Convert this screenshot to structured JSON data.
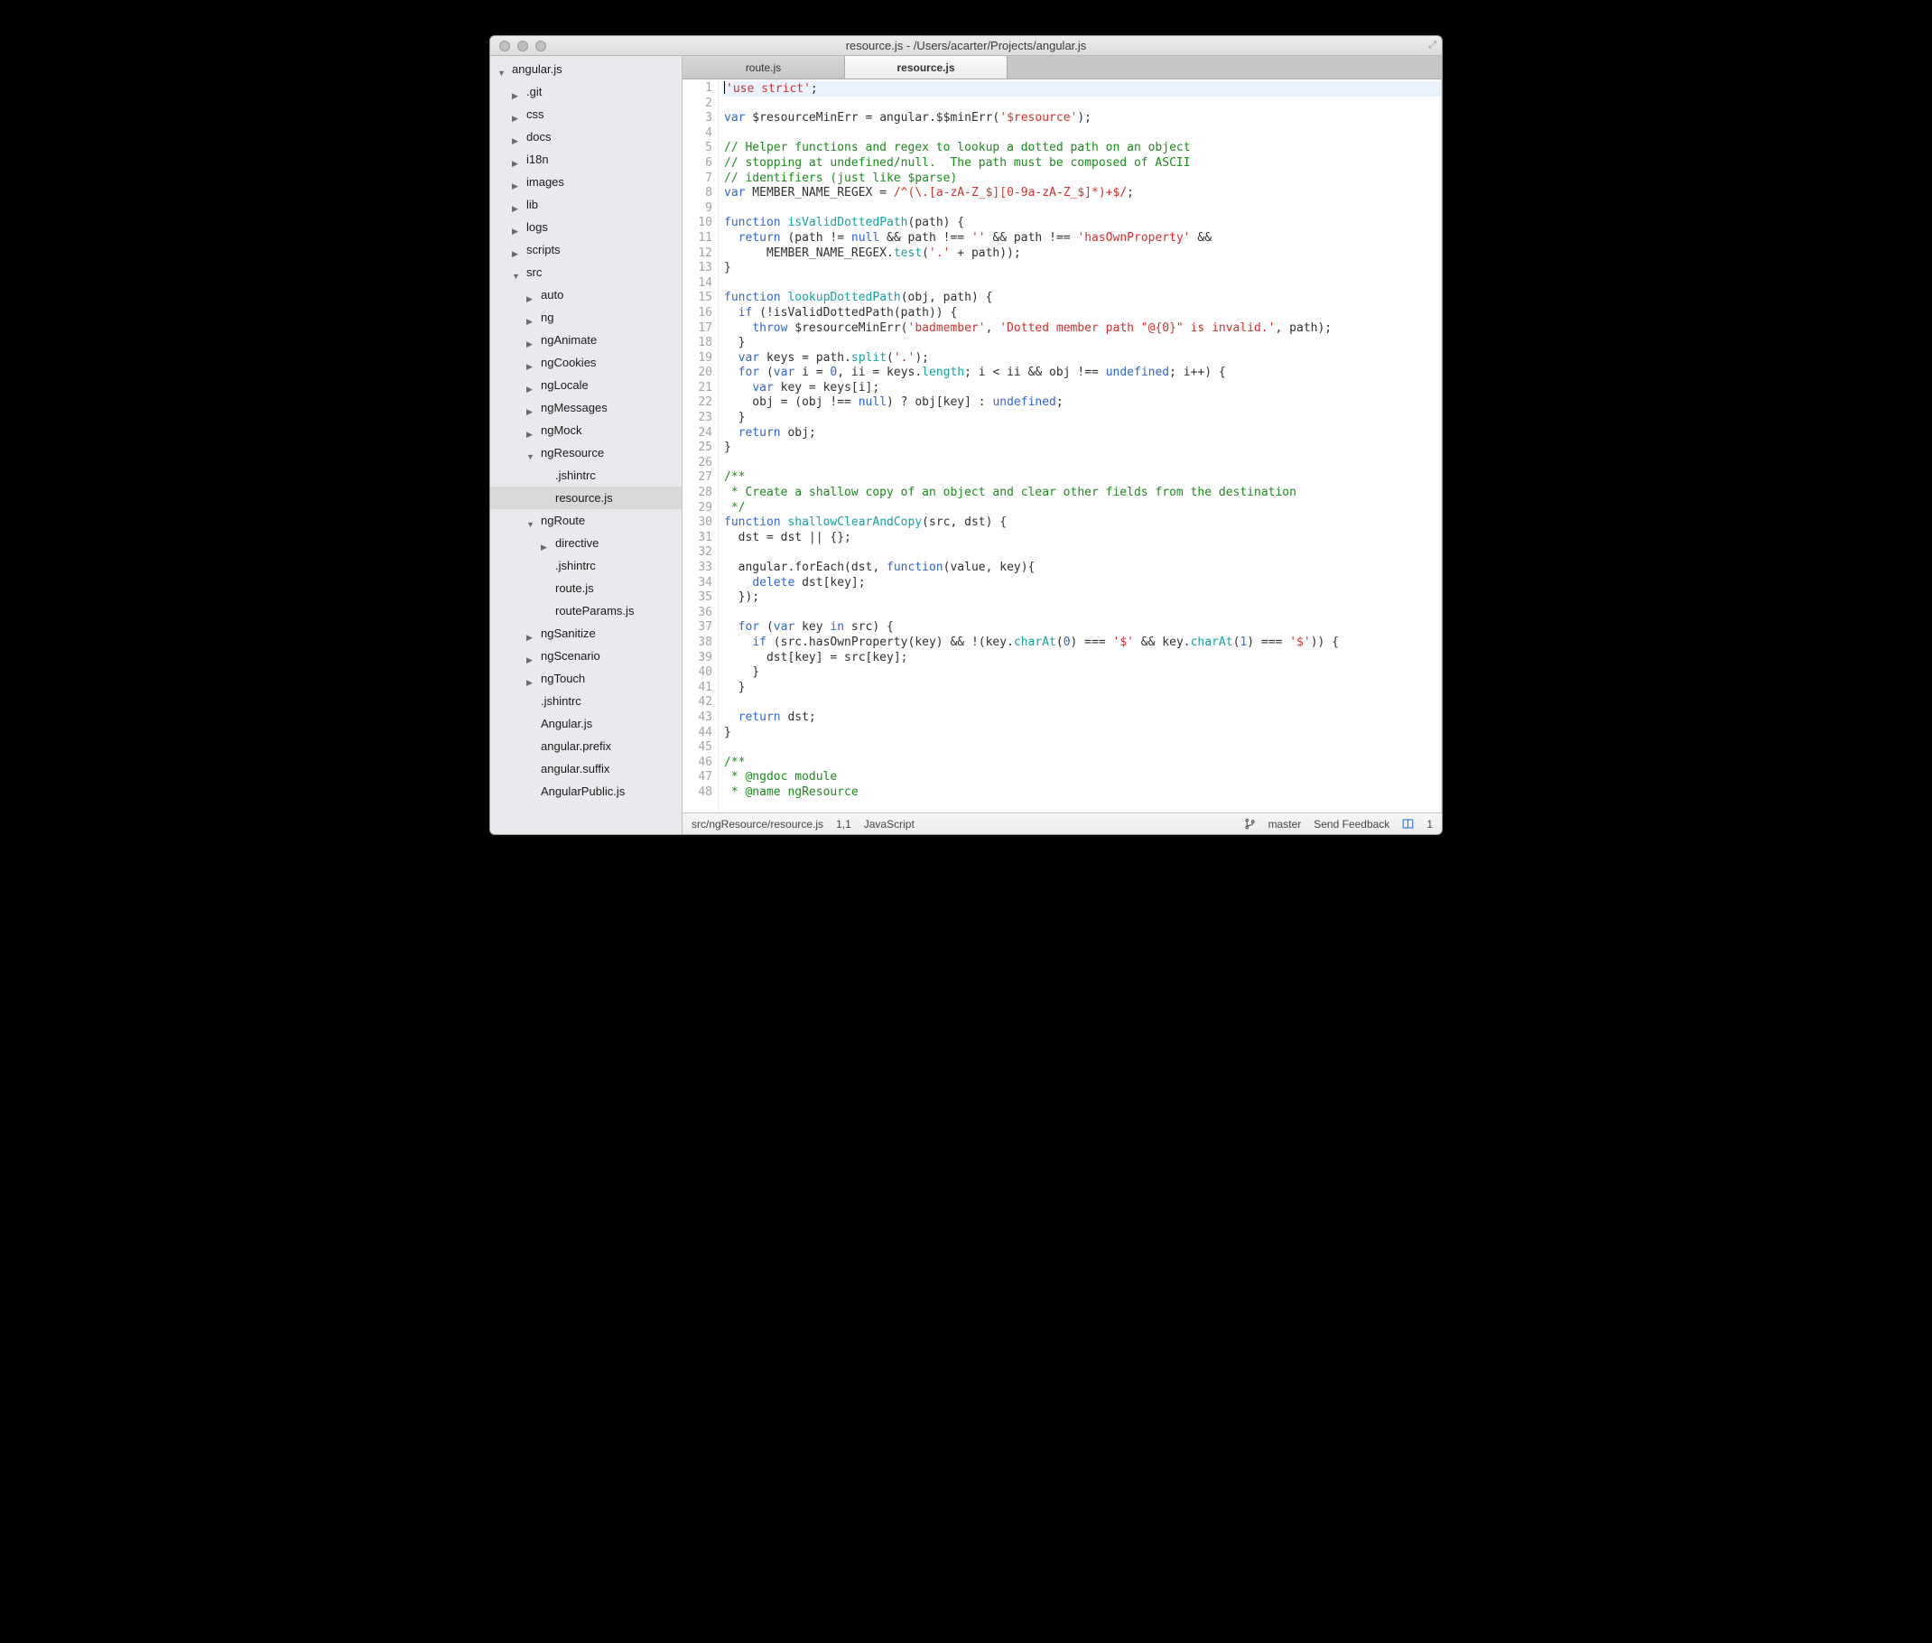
{
  "window": {
    "title": "resource.js - /Users/acarter/Projects/angular.js"
  },
  "tabs": [
    {
      "label": "route.js",
      "active": false
    },
    {
      "label": "resource.js",
      "active": true
    }
  ],
  "tree": [
    {
      "depth": 0,
      "arrow": "down",
      "label": "angular.js"
    },
    {
      "depth": 1,
      "arrow": "right",
      "label": ".git"
    },
    {
      "depth": 1,
      "arrow": "right",
      "label": "css"
    },
    {
      "depth": 1,
      "arrow": "right",
      "label": "docs"
    },
    {
      "depth": 1,
      "arrow": "right",
      "label": "i18n"
    },
    {
      "depth": 1,
      "arrow": "right",
      "label": "images"
    },
    {
      "depth": 1,
      "arrow": "right",
      "label": "lib"
    },
    {
      "depth": 1,
      "arrow": "right",
      "label": "logs"
    },
    {
      "depth": 1,
      "arrow": "right",
      "label": "scripts"
    },
    {
      "depth": 1,
      "arrow": "down",
      "label": "src"
    },
    {
      "depth": 2,
      "arrow": "right",
      "label": "auto"
    },
    {
      "depth": 2,
      "arrow": "right",
      "label": "ng"
    },
    {
      "depth": 2,
      "arrow": "right",
      "label": "ngAnimate"
    },
    {
      "depth": 2,
      "arrow": "right",
      "label": "ngCookies"
    },
    {
      "depth": 2,
      "arrow": "right",
      "label": "ngLocale"
    },
    {
      "depth": 2,
      "arrow": "right",
      "label": "ngMessages"
    },
    {
      "depth": 2,
      "arrow": "right",
      "label": "ngMock"
    },
    {
      "depth": 2,
      "arrow": "down",
      "label": "ngResource"
    },
    {
      "depth": 3,
      "arrow": "none",
      "label": ".jshintrc"
    },
    {
      "depth": 3,
      "arrow": "none",
      "label": "resource.js",
      "selected": true
    },
    {
      "depth": 2,
      "arrow": "down",
      "label": "ngRoute"
    },
    {
      "depth": 3,
      "arrow": "right",
      "label": "directive"
    },
    {
      "depth": 3,
      "arrow": "none",
      "label": ".jshintrc"
    },
    {
      "depth": 3,
      "arrow": "none",
      "label": "route.js"
    },
    {
      "depth": 3,
      "arrow": "none",
      "label": "routeParams.js"
    },
    {
      "depth": 2,
      "arrow": "right",
      "label": "ngSanitize"
    },
    {
      "depth": 2,
      "arrow": "right",
      "label": "ngScenario"
    },
    {
      "depth": 2,
      "arrow": "right",
      "label": "ngTouch"
    },
    {
      "depth": 2,
      "arrow": "none",
      "label": ".jshintrc"
    },
    {
      "depth": 2,
      "arrow": "none",
      "label": "Angular.js"
    },
    {
      "depth": 2,
      "arrow": "none",
      "label": "angular.prefix"
    },
    {
      "depth": 2,
      "arrow": "none",
      "label": "angular.suffix"
    },
    {
      "depth": 2,
      "arrow": "none",
      "label": "AngularPublic.js"
    }
  ],
  "status": {
    "path": "src/ngResource/resource.js",
    "cursor": "1,1",
    "lang": "JavaScript",
    "branch": "master",
    "feedback": "Send Feedback",
    "panes": "1"
  },
  "editor": {
    "first_line": 1,
    "current_line": 1,
    "lines_tokens": [
      [
        [
          "caret",
          ""
        ],
        [
          "s",
          "'use strict'"
        ],
        [
          "",
          ";"
        ]
      ],
      [],
      [
        [
          "k",
          "var"
        ],
        [
          "",
          " $resourceMinErr = angular.$$minErr("
        ],
        [
          "s",
          "'$resource'"
        ],
        [
          "",
          ");"
        ]
      ],
      [],
      [
        [
          "c",
          "// Helper functions and regex to lookup a dotted path on an object"
        ]
      ],
      [
        [
          "c",
          "// stopping at undefined/null.  The path must be composed of ASCII"
        ]
      ],
      [
        [
          "c",
          "// identifiers (just like $parse)"
        ]
      ],
      [
        [
          "k",
          "var"
        ],
        [
          "",
          " MEMBER_NAME_REGEX = "
        ],
        [
          "s",
          "/^(\\.[a-zA-Z_$][0-9a-zA-Z_$]*)+$/"
        ],
        [
          "",
          ";"
        ]
      ],
      [],
      [
        [
          "k",
          "function"
        ],
        [
          "",
          " "
        ],
        [
          "m",
          "isValidDottedPath"
        ],
        [
          "",
          "(path) {"
        ]
      ],
      [
        [
          "",
          "  "
        ],
        [
          "k",
          "return"
        ],
        [
          "",
          " (path != "
        ],
        [
          "n",
          "null"
        ],
        [
          "",
          " && path !== "
        ],
        [
          "s",
          "''"
        ],
        [
          "",
          " && path !== "
        ],
        [
          "s",
          "'hasOwnProperty'"
        ],
        [
          "",
          " &&"
        ]
      ],
      [
        [
          "",
          "      MEMBER_NAME_REGEX."
        ],
        [
          "m",
          "test"
        ],
        [
          "",
          "("
        ],
        [
          "s",
          "'.'"
        ],
        [
          "",
          " + path));"
        ]
      ],
      [
        [
          "",
          "}"
        ]
      ],
      [],
      [
        [
          "k",
          "function"
        ],
        [
          "",
          " "
        ],
        [
          "m",
          "lookupDottedPath"
        ],
        [
          "",
          "(obj, path) {"
        ]
      ],
      [
        [
          "",
          "  "
        ],
        [
          "k",
          "if"
        ],
        [
          "",
          " (!isValidDottedPath(path)) {"
        ]
      ],
      [
        [
          "",
          "    "
        ],
        [
          "k",
          "throw"
        ],
        [
          "",
          " $resourceMinErr("
        ],
        [
          "s",
          "'badmember'"
        ],
        [
          "",
          ", "
        ],
        [
          "s",
          "'Dotted member path \"@{0}\" is invalid.'"
        ],
        [
          "",
          ", path);"
        ]
      ],
      [
        [
          "",
          "  }"
        ]
      ],
      [
        [
          "",
          "  "
        ],
        [
          "k",
          "var"
        ],
        [
          "",
          " keys = path."
        ],
        [
          "m",
          "split"
        ],
        [
          "",
          "("
        ],
        [
          "s",
          "'.'"
        ],
        [
          "",
          ");"
        ]
      ],
      [
        [
          "",
          "  "
        ],
        [
          "k",
          "for"
        ],
        [
          "",
          " ("
        ],
        [
          "k",
          "var"
        ],
        [
          "",
          " i = "
        ],
        [
          "n",
          "0"
        ],
        [
          "",
          ", ii = keys."
        ],
        [
          "m",
          "length"
        ],
        [
          "",
          "; i < ii && obj !== "
        ],
        [
          "n",
          "undefined"
        ],
        [
          "",
          "; i++) {"
        ]
      ],
      [
        [
          "",
          "    "
        ],
        [
          "k",
          "var"
        ],
        [
          "",
          " key = keys[i];"
        ]
      ],
      [
        [
          "",
          "    obj = (obj !== "
        ],
        [
          "n",
          "null"
        ],
        [
          "",
          ") ? obj[key] : "
        ],
        [
          "n",
          "undefined"
        ],
        [
          "",
          ";"
        ]
      ],
      [
        [
          "",
          "  }"
        ]
      ],
      [
        [
          "",
          "  "
        ],
        [
          "k",
          "return"
        ],
        [
          "",
          " obj;"
        ]
      ],
      [
        [
          "",
          "}"
        ]
      ],
      [],
      [
        [
          "c",
          "/**"
        ]
      ],
      [
        [
          "c",
          " * Create a shallow copy of an object and clear other fields from the destination"
        ]
      ],
      [
        [
          "c",
          " */"
        ]
      ],
      [
        [
          "k",
          "function"
        ],
        [
          "",
          " "
        ],
        [
          "m",
          "shallowClearAndCopy"
        ],
        [
          "",
          "(src, dst) {"
        ]
      ],
      [
        [
          "",
          "  dst = dst || {};"
        ]
      ],
      [],
      [
        [
          "",
          "  angular.forEach(dst, "
        ],
        [
          "k",
          "function"
        ],
        [
          "",
          "(value, key){"
        ]
      ],
      [
        [
          "",
          "    "
        ],
        [
          "k",
          "delete"
        ],
        [
          "",
          " dst[key];"
        ]
      ],
      [
        [
          "",
          "  });"
        ]
      ],
      [],
      [
        [
          "",
          "  "
        ],
        [
          "k",
          "for"
        ],
        [
          "",
          " ("
        ],
        [
          "k",
          "var"
        ],
        [
          "",
          " key "
        ],
        [
          "k",
          "in"
        ],
        [
          "",
          " src) {"
        ]
      ],
      [
        [
          "",
          "    "
        ],
        [
          "k",
          "if"
        ],
        [
          "",
          " (src.hasOwnProperty(key) && !(key."
        ],
        [
          "m",
          "charAt"
        ],
        [
          "",
          "("
        ],
        [
          "n",
          "0"
        ],
        [
          "",
          ") === "
        ],
        [
          "s",
          "'$'"
        ],
        [
          "",
          " && key."
        ],
        [
          "m",
          "charAt"
        ],
        [
          "",
          "("
        ],
        [
          "n",
          "1"
        ],
        [
          "",
          ") === "
        ],
        [
          "s",
          "'$'"
        ],
        [
          "",
          ")) {"
        ]
      ],
      [
        [
          "",
          "      dst[key] = src[key];"
        ]
      ],
      [
        [
          "",
          "    }"
        ]
      ],
      [
        [
          "",
          "  }"
        ]
      ],
      [],
      [
        [
          "",
          "  "
        ],
        [
          "k",
          "return"
        ],
        [
          "",
          " dst;"
        ]
      ],
      [
        [
          "",
          "}"
        ]
      ],
      [],
      [
        [
          "c",
          "/**"
        ]
      ],
      [
        [
          "c",
          " * @ngdoc module"
        ]
      ],
      [
        [
          "c",
          " * @name ngResource"
        ]
      ]
    ]
  }
}
